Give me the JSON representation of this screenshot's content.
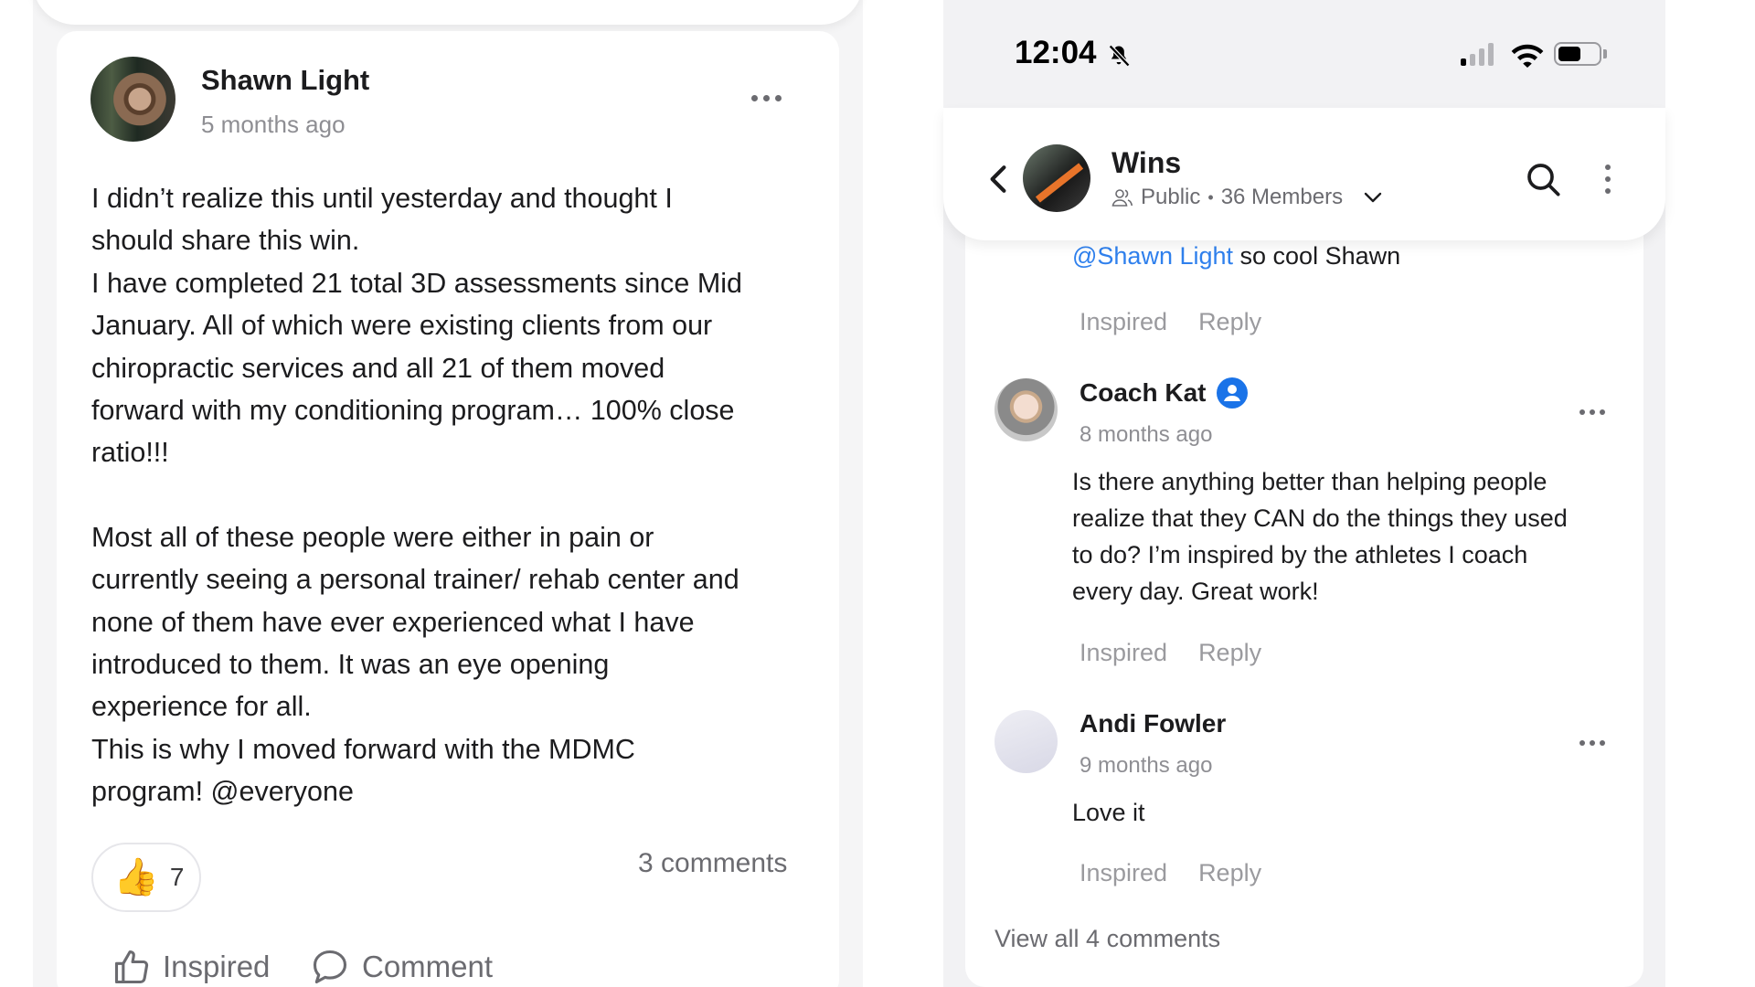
{
  "post": {
    "author": "Shawn Light",
    "time": "5 months ago",
    "paragraph1": "I didn’t realize this until yesterday and thought I\nshould share this win.\nI have completed 21 total 3D assessments since Mid\nJanuary.  All of which were existing clients from our\nchiropractic services and all 21 of them moved\nforward with my conditioning program… 100% close\nratio!!!",
    "paragraph2": "Most all of these people were either in pain or\ncurrently seeing a personal trainer/ rehab center and\nnone of them have ever experienced what I have\nintroduced to them.  It was an eye opening\nexperience for all.\nThis is why I moved forward with the MDMC\nprogram!  @everyone",
    "reaction_emoji": "👍",
    "reaction_count": "7",
    "comments_count": "3 comments",
    "action_inspired": "Inspired",
    "action_comment": "Comment"
  },
  "phone": {
    "status_time": "12:04",
    "group": {
      "name": "Wins",
      "visibility": "Public",
      "separator": "•",
      "members": "36 Members"
    },
    "first_reply": {
      "mention": "@Shawn Light",
      "text": " so cool Shawn",
      "inspired": "Inspired",
      "reply": "Reply"
    },
    "comments": [
      {
        "author": "Coach Kat",
        "time": "8 months ago",
        "text": "Is there anything better than helping people\nrealize that they CAN do the things they used\nto do? I’m inspired by the athletes I coach\nevery day. Great work!",
        "inspired": "Inspired",
        "reply": "Reply"
      },
      {
        "author": "Andi Fowler",
        "time": "9 months ago",
        "text": "Love it",
        "inspired": "Inspired",
        "reply": "Reply"
      }
    ],
    "view_all": "View all 4 comments"
  },
  "colors": {
    "mention": "#2f80ed",
    "badge": "#1a73e8",
    "muted_text": "#8e8e93"
  }
}
